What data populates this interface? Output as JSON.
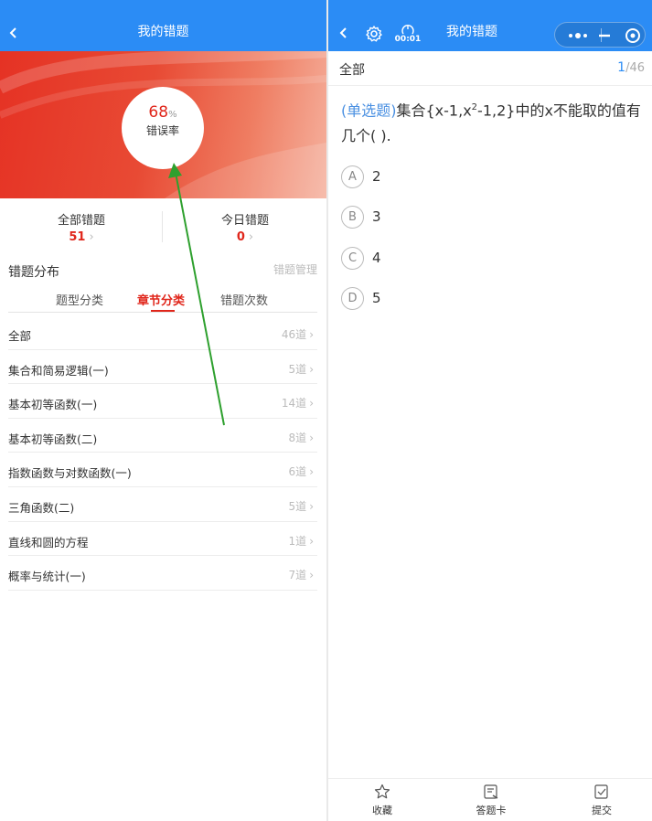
{
  "left": {
    "header": {
      "title": "我的错题"
    },
    "rate": {
      "value": "68",
      "unit": "%",
      "label": "错误率"
    },
    "stats": [
      {
        "title": "全部错题",
        "value": "51"
      },
      {
        "title": "今日错题",
        "value": "0"
      }
    ],
    "distribution": {
      "title": "错题分布",
      "manage": "错题管理"
    },
    "tabs": [
      {
        "label": "题型分类"
      },
      {
        "label": "章节分类"
      },
      {
        "label": "错题次数"
      }
    ],
    "active_tab": 1,
    "rows": [
      {
        "name": "全部",
        "count": "46道"
      },
      {
        "name": "集合和简易逻辑(一)",
        "count": "5道"
      },
      {
        "name": "基本初等函数(一)",
        "count": "14道"
      },
      {
        "name": "基本初等函数(二)",
        "count": "8道"
      },
      {
        "name": "指数函数与对数函数(一)",
        "count": "6道"
      },
      {
        "name": "三角函数(二)",
        "count": "5道"
      },
      {
        "name": "直线和圆的方程",
        "count": "1道"
      },
      {
        "name": "概率与统计(一)",
        "count": "7道"
      }
    ],
    "chevron": "›",
    "colors": {
      "header": "#2b8cf5",
      "accent": "#e0261b",
      "banner": "#e53224"
    }
  },
  "right": {
    "header": {
      "title": "我的错题",
      "timer": "00:01"
    },
    "filter": "全部",
    "progress": {
      "current": "1",
      "total": "/46"
    },
    "question": {
      "type": "(单选题)",
      "text_a": "集合{x-1,x",
      "sup": "2",
      "text_b": "-1,2}中的x不能取的值有几个( )."
    },
    "options": [
      {
        "letter": "A",
        "text": "2"
      },
      {
        "letter": "B",
        "text": "3"
      },
      {
        "letter": "C",
        "text": "4"
      },
      {
        "letter": "D",
        "text": "5"
      }
    ],
    "bottom": [
      {
        "label": "收藏",
        "icon": "star-icon"
      },
      {
        "label": "答题卡",
        "icon": "answer-card-icon"
      },
      {
        "label": "提交",
        "icon": "submit-icon"
      }
    ]
  }
}
